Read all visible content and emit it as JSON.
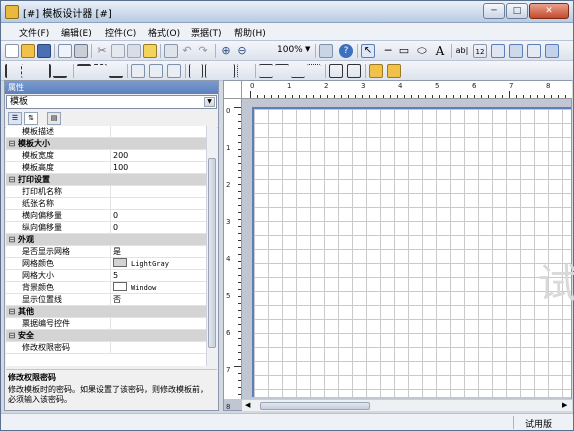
{
  "window": {
    "title": "[#] 模板设计器 [#]",
    "controls": [
      "minimize-icon",
      "maximize-icon",
      "close-icon"
    ]
  },
  "menu": [
    "文件(F)",
    "编辑(E)",
    "控件(C)",
    "格式(O)",
    "票据(T)",
    "帮助(H)"
  ],
  "toolbar": {
    "zoom": "100%"
  },
  "props": {
    "header": "属性",
    "object": "模板",
    "rows": [
      {
        "type": "prop",
        "name": "模板描述",
        "value": ""
      },
      {
        "type": "cat",
        "name": "模板大小"
      },
      {
        "type": "prop",
        "name": "模板宽度",
        "value": "200"
      },
      {
        "type": "prop",
        "name": "模板高度",
        "value": "100"
      },
      {
        "type": "cat",
        "name": "打印设置"
      },
      {
        "type": "prop",
        "name": "打印机名称",
        "value": ""
      },
      {
        "type": "prop",
        "name": "纸张名称",
        "value": ""
      },
      {
        "type": "prop",
        "name": "横向偏移量",
        "value": "0"
      },
      {
        "type": "prop",
        "name": "纵向偏移量",
        "value": "0"
      },
      {
        "type": "cat",
        "name": "外观"
      },
      {
        "type": "prop",
        "name": "是否显示网格",
        "value": "是"
      },
      {
        "type": "color",
        "name": "网格颜色",
        "value": "LightGray",
        "swatch": "#d3d3d3"
      },
      {
        "type": "prop",
        "name": "网格大小",
        "value": "5"
      },
      {
        "type": "color",
        "name": "背景颜色",
        "value": "Window",
        "swatch": "#ffffff"
      },
      {
        "type": "prop",
        "name": "显示位置线",
        "value": "否"
      },
      {
        "type": "cat",
        "name": "其他"
      },
      {
        "type": "prop",
        "name": "票据编号控件",
        "value": ""
      },
      {
        "type": "cat",
        "name": "安全"
      },
      {
        "type": "prop",
        "name": "修改权限密码",
        "value": ""
      }
    ],
    "desc_title": "修改权限密码",
    "desc_text": "修改模板时的密码。如果设置了该密码，则修改模板前，必须输入该密码。"
  },
  "rulers": {
    "h": [
      "0",
      "1",
      "2",
      "3",
      "4",
      "5",
      "6",
      "7",
      "8"
    ],
    "v": [
      "0",
      "1",
      "2",
      "3",
      "4",
      "5",
      "6",
      "7",
      "8"
    ]
  },
  "watermark": "试",
  "status": "试用版",
  "colors": {
    "accent": "#5c7fb8",
    "grid": "#c9c9c9"
  }
}
